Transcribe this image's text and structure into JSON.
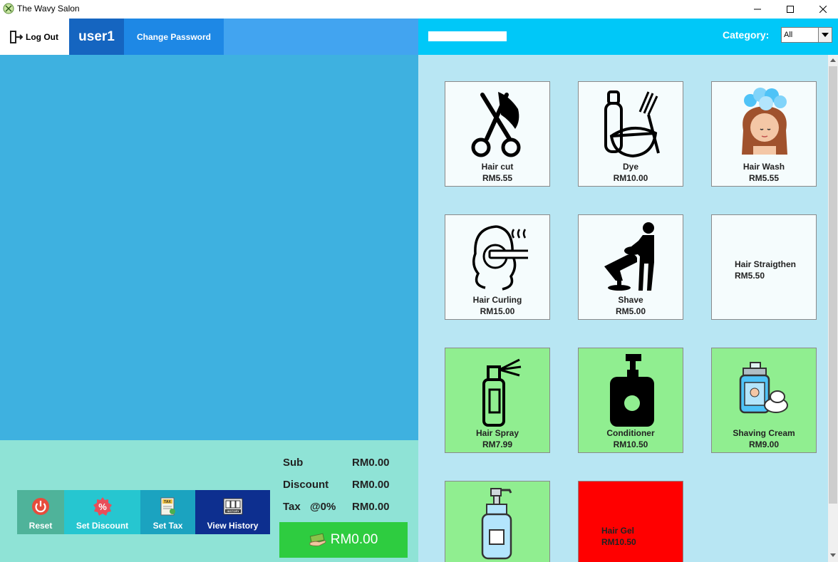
{
  "window": {
    "title": "The Wavy Salon"
  },
  "header": {
    "logout_label": "Log Out",
    "username": "user1",
    "change_password_label": "Change Password"
  },
  "search": {
    "value": "",
    "placeholder": ""
  },
  "category": {
    "label": "Category:",
    "selected": "All"
  },
  "actions": {
    "reset": "Reset",
    "set_discount": "Set Discount",
    "set_tax": "Set Tax",
    "view_history": "View History",
    "tax_icon_text": "TAX",
    "history_icon_text": "HISTORY"
  },
  "summary": {
    "sub_label": "Sub",
    "sub_value": "RM0.00",
    "discount_label": "Discount",
    "discount_value": "RM0.00",
    "tax_label": "Tax",
    "tax_rate": "@0%",
    "tax_value": "RM0.00",
    "total": "RM0.00"
  },
  "products": [
    {
      "name": "Hair cut",
      "price": "RM5.55",
      "icon": "scissors-icon",
      "bg": "#f5fcfd"
    },
    {
      "name": "Dye",
      "price": "RM10.00",
      "icon": "dye-bowl-icon",
      "bg": "#f5fcfd"
    },
    {
      "name": "Hair Wash",
      "price": "RM5.55",
      "icon": "hair-wash-icon",
      "bg": "#f5fcfd"
    },
    {
      "name": "Hair Curling",
      "price": "RM15.00",
      "icon": "hair-curling-icon",
      "bg": "#f5fcfd"
    },
    {
      "name": "Shave",
      "price": "RM5.00",
      "icon": "barber-chair-icon",
      "bg": "#f5fcfd"
    },
    {
      "name": "Hair Straigthen",
      "price": "RM5.50",
      "icon": "",
      "bg": "#f5fcfd"
    },
    {
      "name": "Hair Spray",
      "price": "RM7.99",
      "icon": "spray-bottle-icon",
      "bg": "#90ee90"
    },
    {
      "name": "Conditioner",
      "price": "RM10.50",
      "icon": "pump-bottle-icon",
      "bg": "#90ee90"
    },
    {
      "name": "Shaving Cream",
      "price": "RM9.00",
      "icon": "shaving-cream-icon",
      "bg": "#90ee90"
    },
    {
      "name": "",
      "price": "",
      "icon": "pump-bottle-blue-icon",
      "bg": "#90ee90"
    },
    {
      "name": "Hair Gel",
      "price": "RM10.50",
      "icon": "",
      "bg": "#ff0000"
    }
  ]
}
